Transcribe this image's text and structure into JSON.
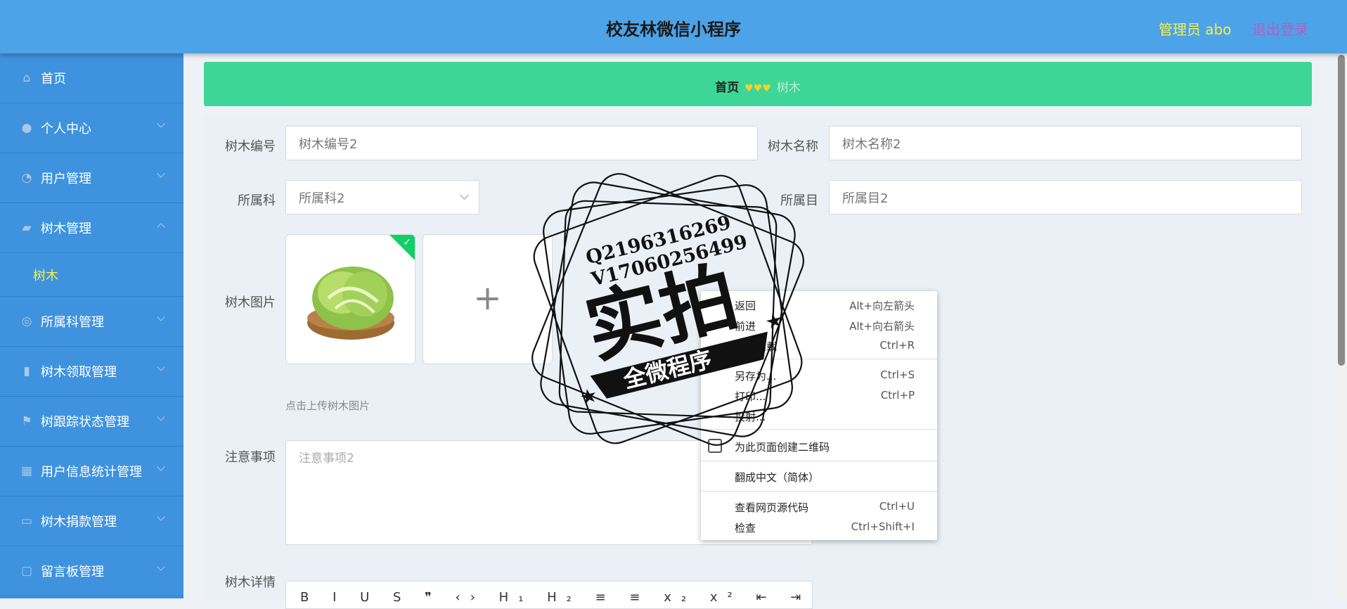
{
  "header": {
    "title": "校友林微信小程序",
    "admin": "管理员 abo",
    "logout": "退出登录"
  },
  "sidebar": {
    "items": [
      {
        "label": "首页",
        "icon": "home-icon"
      },
      {
        "label": "个人中心",
        "icon": "user-icon"
      },
      {
        "label": "用户管理",
        "icon": "gauge-icon"
      },
      {
        "label": "树木管理",
        "icon": "chat-icon"
      },
      {
        "label": "树木",
        "icon": ""
      },
      {
        "label": "所属科管理",
        "icon": "compass-icon"
      },
      {
        "label": "树木领取管理",
        "icon": "bar-chart-icon"
      },
      {
        "label": "树跟踪状态管理",
        "icon": "flag-icon"
      },
      {
        "label": "用户信息统计管理",
        "icon": "grid-icon"
      },
      {
        "label": "树木捐款管理",
        "icon": "monitor-icon"
      },
      {
        "label": "留言板管理",
        "icon": "message-icon"
      }
    ]
  },
  "breadcrumb": {
    "home": "首页",
    "hearts": "♥♥♥",
    "current": "树木"
  },
  "form": {
    "tree_no_label": "树木编号",
    "tree_no_value": "树木编号2",
    "tree_name_label": "树木名称",
    "tree_name_value": "树木名称2",
    "family_label": "所属科",
    "family_value": "所属科2",
    "order_label": "所属目",
    "order_value": "所属目2",
    "image_label": "树木图片",
    "upload_tip": "点击上传树木图片",
    "notes_label": "注意事项",
    "notes_placeholder": "注意事项2",
    "detail_label": "树木详情",
    "editor_toolbar": "B I U S ❞ ‹› H₁ H₂ ≡ ≡ x₂ x² ⇤ ⇥"
  },
  "context_menu": {
    "items": [
      {
        "label": "返回",
        "shortcut": "Alt+向左箭头"
      },
      {
        "label": "前进",
        "shortcut": "Alt+向右箭头"
      },
      {
        "label": "重新加载",
        "shortcut": "Ctrl+R"
      },
      {
        "label": "另存为...",
        "shortcut": "Ctrl+S"
      },
      {
        "label": "打印...",
        "shortcut": "Ctrl+P"
      },
      {
        "label": "投射...",
        "shortcut": ""
      },
      {
        "label": "为此页面创建二维码",
        "shortcut": ""
      },
      {
        "label": "翻成中文（简体）",
        "shortcut": ""
      },
      {
        "label": "查看网页源代码",
        "shortcut": "Ctrl+U"
      },
      {
        "label": "检查",
        "shortcut": "Ctrl+Shift+I"
      }
    ]
  },
  "stamp": {
    "line1": "Q2196316269",
    "line2": "V17060256499",
    "big": "实拍",
    "banner": "全微程序"
  }
}
